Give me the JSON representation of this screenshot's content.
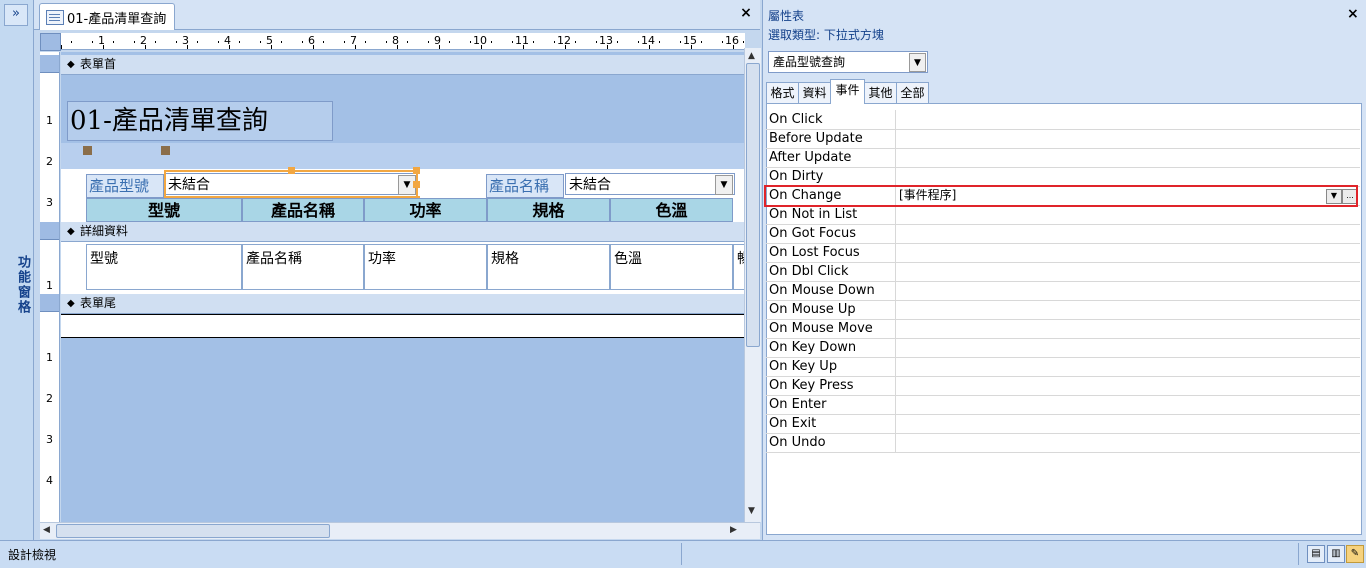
{
  "nav": {
    "toggle": "»",
    "title": "功能窗格"
  },
  "document": {
    "tab_title": "01-產品清單查詢",
    "close": "×",
    "ruler_top": [
      "1",
      "2",
      "3",
      "4",
      "5",
      "6",
      "7",
      "8",
      "9",
      "10",
      "11",
      "12",
      "13",
      "14",
      "15",
      "16"
    ],
    "ruler_left_header": [
      "1",
      "2",
      "3"
    ],
    "ruler_left_detail": [
      "1"
    ],
    "ruler_left_footer": [
      "1",
      "2",
      "3",
      "4"
    ],
    "sections": {
      "header": "表單首",
      "detail": "詳細資料",
      "footer": "表單尾"
    },
    "form_title": "01-產品清單查詢",
    "filters": [
      {
        "label": "產品型號",
        "value": "未結合"
      },
      {
        "label": "產品名稱",
        "value": "未結合"
      }
    ],
    "columns": [
      "型號",
      "產品名稱",
      "功率",
      "規格",
      "色溫"
    ],
    "detail_fields": [
      "型號",
      "產品名稱",
      "功率",
      "規格",
      "色溫"
    ],
    "detail_cutoff": "暢"
  },
  "property_sheet": {
    "title": "屬性表",
    "close": "×",
    "selection_type": "選取類型:  下拉式方塊",
    "object": "產品型號查詢",
    "tabs": [
      "格式",
      "資料",
      "事件",
      "其他",
      "全部"
    ],
    "active_tab": "事件",
    "events": [
      {
        "name": "On Click",
        "value": ""
      },
      {
        "name": "Before Update",
        "value": ""
      },
      {
        "name": "After Update",
        "value": ""
      },
      {
        "name": "On Dirty",
        "value": ""
      },
      {
        "name": "On Change",
        "value": "[事件程序]"
      },
      {
        "name": "On Not in List",
        "value": ""
      },
      {
        "name": "On Got Focus",
        "value": ""
      },
      {
        "name": "On Lost Focus",
        "value": ""
      },
      {
        "name": "On Dbl Click",
        "value": ""
      },
      {
        "name": "On Mouse Down",
        "value": ""
      },
      {
        "name": "On Mouse Up",
        "value": ""
      },
      {
        "name": "On Mouse Move",
        "value": ""
      },
      {
        "name": "On Key Down",
        "value": ""
      },
      {
        "name": "On Key Up",
        "value": ""
      },
      {
        "name": "On Key Press",
        "value": ""
      },
      {
        "name": "On Enter",
        "value": ""
      },
      {
        "name": "On Exit",
        "value": ""
      },
      {
        "name": "On Undo",
        "value": ""
      }
    ],
    "builder_button": "..."
  },
  "status": {
    "text": "設計檢視"
  },
  "colors": {
    "accent": "#15428b",
    "selection": "#f2a742",
    "highlight_row": "#e0242a",
    "column_header": "#a9d6e6"
  }
}
